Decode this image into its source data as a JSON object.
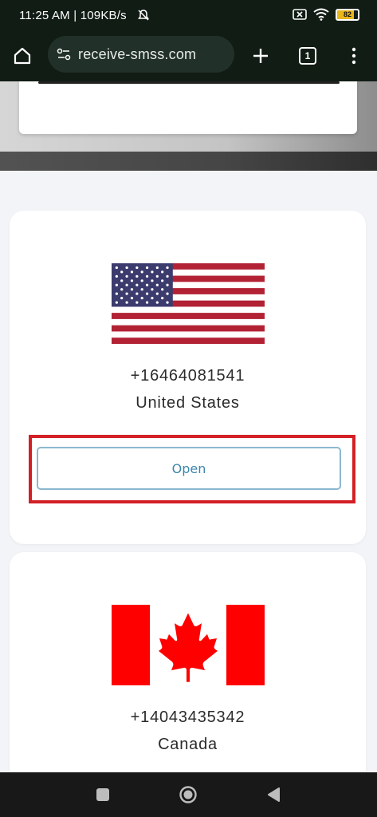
{
  "status_bar": {
    "time_speed": "11:25 AM | 109KB/s",
    "battery": "82",
    "battery_color": "#e8b61b"
  },
  "browser": {
    "url": "receive-smss.com",
    "tab_count": "1",
    "icons": [
      "home-icon",
      "site-settings-icon",
      "new-tab-icon",
      "tabs-icon",
      "menu-icon"
    ]
  },
  "cards": [
    {
      "phone": "+16464081541",
      "country": "United States",
      "button_label": "Open",
      "flag_icon": "us-flag-icon"
    },
    {
      "phone": "+14043435342",
      "country": "Canada",
      "flag_icon": "canada-flag-icon"
    }
  ],
  "colors": {
    "highlight_border": "#d32026",
    "button_text": "#3d86ad",
    "button_border": "#8cb8cf",
    "chrome_bg": "#111c15"
  },
  "nav_bar": {
    "icons": [
      "recents-icon",
      "home-circle-icon",
      "back-icon"
    ]
  }
}
